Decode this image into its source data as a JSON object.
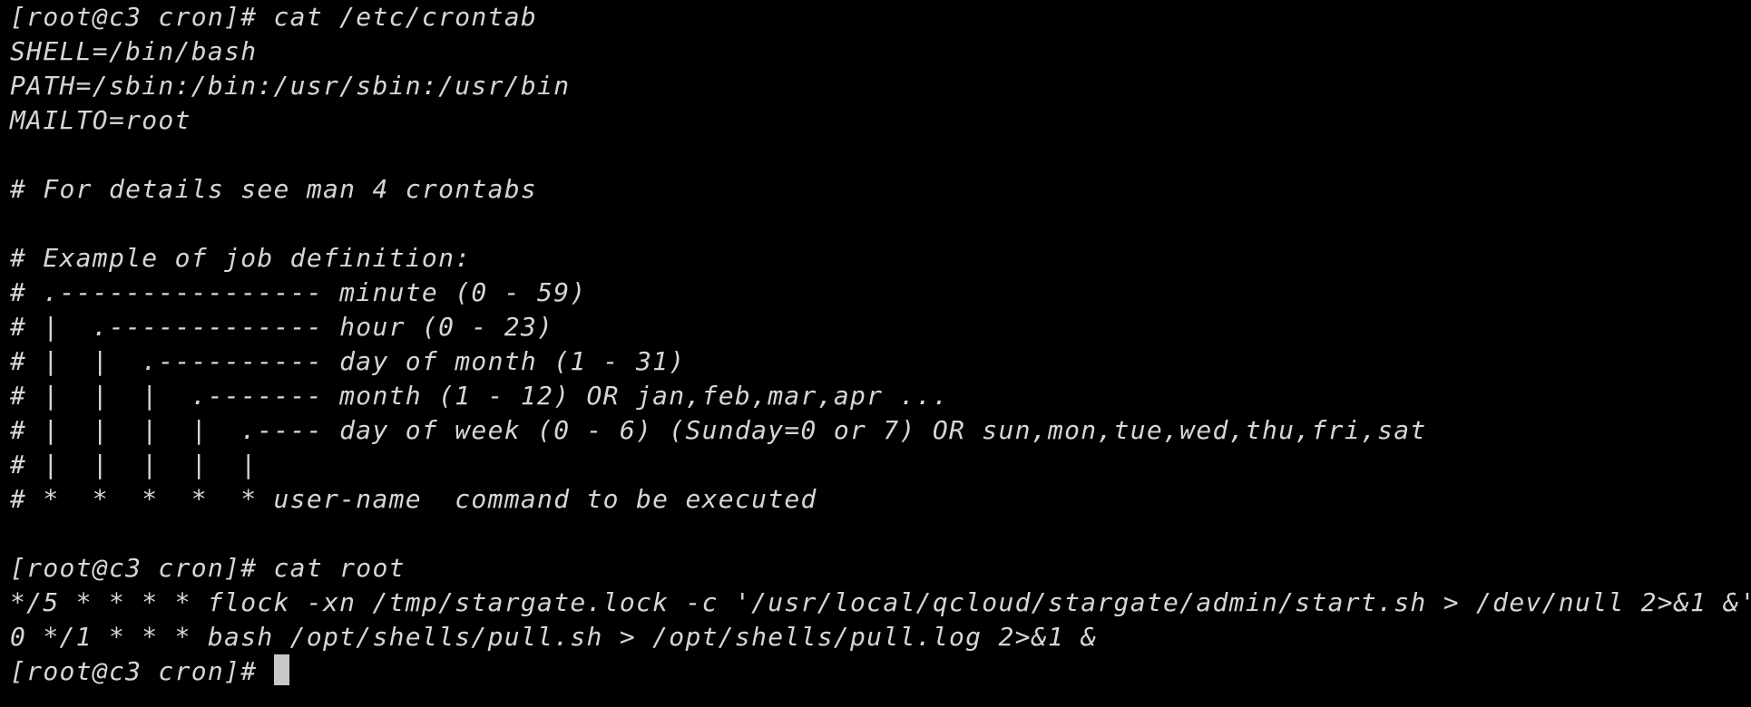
{
  "terminal": {
    "lines": [
      "[root@c3 cron]# cat /etc/crontab",
      "SHELL=/bin/bash",
      "PATH=/sbin:/bin:/usr/sbin:/usr/bin",
      "MAILTO=root",
      "",
      "# For details see man 4 crontabs",
      "",
      "# Example of job definition:",
      "# .---------------- minute (0 - 59)",
      "# |  .------------- hour (0 - 23)",
      "# |  |  .---------- day of month (1 - 31)",
      "# |  |  |  .------- month (1 - 12) OR jan,feb,mar,apr ...",
      "# |  |  |  |  .---- day of week (0 - 6) (Sunday=0 or 7) OR sun,mon,tue,wed,thu,fri,sat",
      "# |  |  |  |  |",
      "# *  *  *  *  * user-name  command to be executed",
      "",
      "[root@c3 cron]# cat root",
      "*/5 * * * * flock -xn /tmp/stargate.lock -c '/usr/local/qcloud/stargate/admin/start.sh > /dev/null 2>&1 &'",
      "0 */1 * * * bash /opt/shells/pull.sh > /opt/shells/pull.log 2>&1 &"
    ],
    "prompt": "[root@c3 cron]# "
  }
}
